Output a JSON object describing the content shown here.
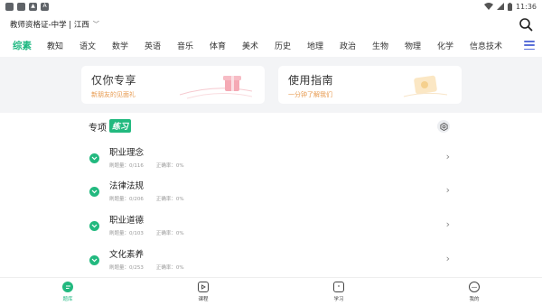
{
  "status_bar": {
    "time": "11:36",
    "left_icons": [
      "notification-icon",
      "notification-icon",
      "image-icon",
      "app-icon"
    ],
    "right_icons": [
      "wifi-icon",
      "signal-icon",
      "battery-icon"
    ]
  },
  "header": {
    "title": "教师资格证-中学 | 江西",
    "search_icon": "search-icon"
  },
  "subject_tabs": [
    {
      "label": "综素",
      "active": true
    },
    {
      "label": "教知",
      "active": false
    },
    {
      "label": "语文",
      "active": false
    },
    {
      "label": "数学",
      "active": false
    },
    {
      "label": "英语",
      "active": false
    },
    {
      "label": "音乐",
      "active": false
    },
    {
      "label": "体育",
      "active": false
    },
    {
      "label": "美术",
      "active": false
    },
    {
      "label": "历史",
      "active": false
    },
    {
      "label": "地理",
      "active": false
    },
    {
      "label": "政治",
      "active": false
    },
    {
      "label": "生物",
      "active": false
    },
    {
      "label": "物理",
      "active": false
    },
    {
      "label": "化学",
      "active": false
    },
    {
      "label": "信息技术",
      "active": false
    }
  ],
  "banners": [
    {
      "title": "仅你专享",
      "subtitle": "新朋友的见面礼",
      "icon": "gift-icon"
    },
    {
      "title": "使用指南",
      "subtitle": "一分钟了解我们",
      "icon": "guide-icon"
    }
  ],
  "section": {
    "title": "专项",
    "badge": "练习",
    "settings_icon": "settings-icon"
  },
  "practice_items": [
    {
      "title": "职业理念",
      "answered": "刷题量：0/116",
      "accuracy": "正确率：0%"
    },
    {
      "title": "法律法规",
      "answered": "刷题量：0/206",
      "accuracy": "正确率：0%"
    },
    {
      "title": "职业道德",
      "answered": "刷题量：0/103",
      "accuracy": "正确率：0%"
    },
    {
      "title": "文化素养",
      "answered": "刷题量：0/253",
      "accuracy": "正确率：0%"
    }
  ],
  "bottom_nav": [
    {
      "label": "题库",
      "icon": "question-bank-icon",
      "active": true
    },
    {
      "label": "课程",
      "icon": "course-play-icon",
      "active": false
    },
    {
      "label": "学习",
      "icon": "study-icon",
      "active": false
    },
    {
      "label": "我的",
      "icon": "profile-chat-icon",
      "active": false
    }
  ],
  "colors": {
    "accent": "#20b882",
    "badge": "#22b97f",
    "banner_subtitle": "#e79a4f",
    "menu": "#5a6fd8"
  }
}
